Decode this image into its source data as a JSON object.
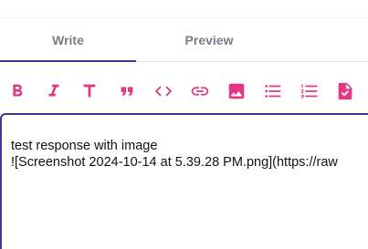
{
  "tabs": [
    {
      "label": "Write",
      "active": true
    },
    {
      "label": "Preview",
      "active": false
    }
  ],
  "toolbar": {
    "accent_color": "#e53583",
    "tools": [
      {
        "name": "bold",
        "icon": "bold-icon"
      },
      {
        "name": "italic",
        "icon": "italic-icon"
      },
      {
        "name": "heading",
        "icon": "heading-icon"
      },
      {
        "name": "quote",
        "icon": "quote-icon"
      },
      {
        "name": "code",
        "icon": "code-icon"
      },
      {
        "name": "link",
        "icon": "link-icon"
      },
      {
        "name": "image",
        "icon": "image-icon"
      },
      {
        "name": "bulleted-list",
        "icon": "bulleted-list-icon"
      },
      {
        "name": "numbered-list",
        "icon": "numbered-list-icon"
      },
      {
        "name": "task-list",
        "icon": "task-list-icon"
      }
    ]
  },
  "editor": {
    "value": "test response with image\n![Screenshot 2024-10-14 at 5.39.28 PM.png](https://raw",
    "border_color": "#3f3a8c"
  }
}
